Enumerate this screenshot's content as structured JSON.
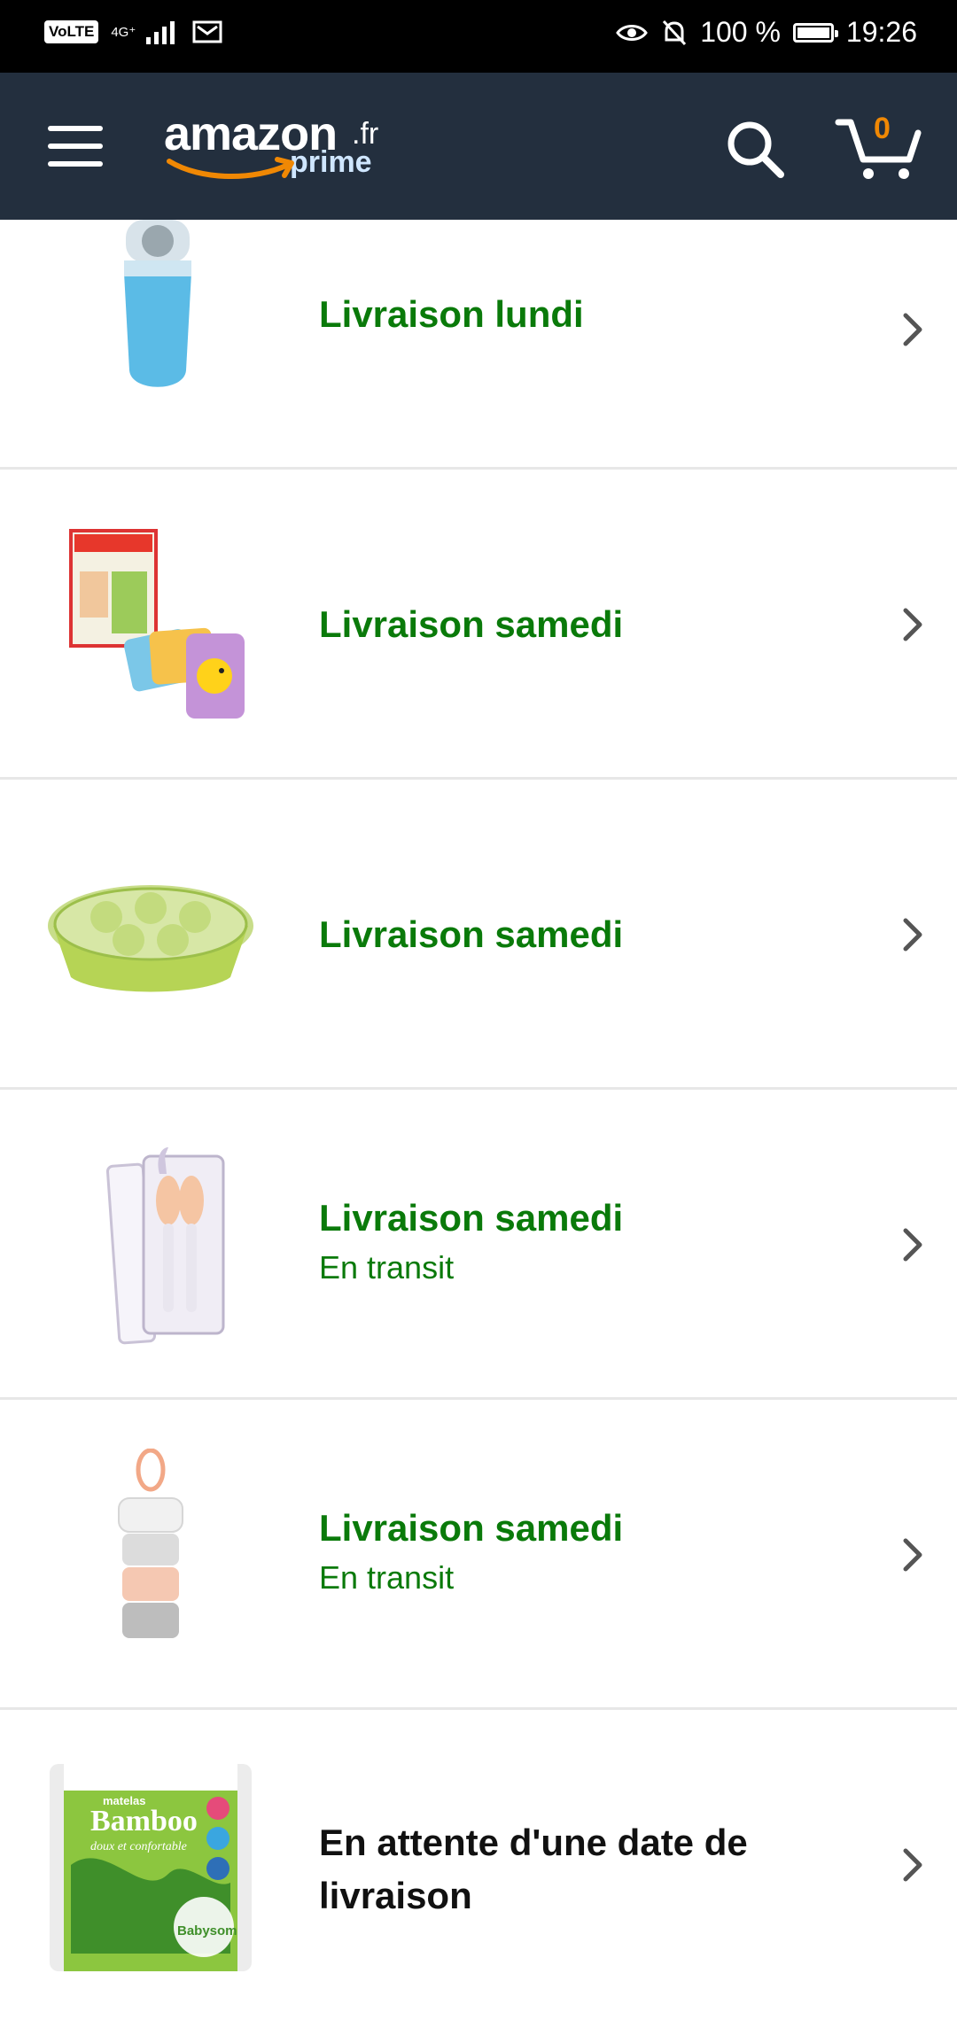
{
  "status_bar": {
    "left_badge": "VoLTE",
    "network": "4G⁺",
    "battery": "100 %",
    "time": "19:26"
  },
  "header": {
    "logo_main": "amazon",
    "logo_tld": ".fr",
    "logo_sub": "prime",
    "cart_count": "0",
    "colors": {
      "bar": "#232f3e",
      "cart_count": "#f08804"
    }
  },
  "orders": [
    {
      "image": "lint-remover-image",
      "status": "Livraison lundi",
      "substatus": ""
    },
    {
      "image": "flash-cards-image",
      "status": "Livraison samedi",
      "substatus": ""
    },
    {
      "image": "freezer-tray-image",
      "status": "Livraison samedi",
      "substatus": ""
    },
    {
      "image": "cutlery-case-image",
      "status": "Livraison samedi",
      "substatus": "En transit"
    },
    {
      "image": "milk-dispenser-image",
      "status": "Livraison samedi",
      "substatus": "En transit"
    },
    {
      "image": "mattress-package-image",
      "status": "En attente d'une date de livraison",
      "substatus": ""
    }
  ],
  "mattress_package_text": {
    "brand": "matelas",
    "name": "Bamboo",
    "tagline": "doux et confortable",
    "maker": "Babysom"
  },
  "colors": {
    "status_green": "#0a7a0a",
    "status_dark": "#111111",
    "divider": "#e7e7e7"
  }
}
